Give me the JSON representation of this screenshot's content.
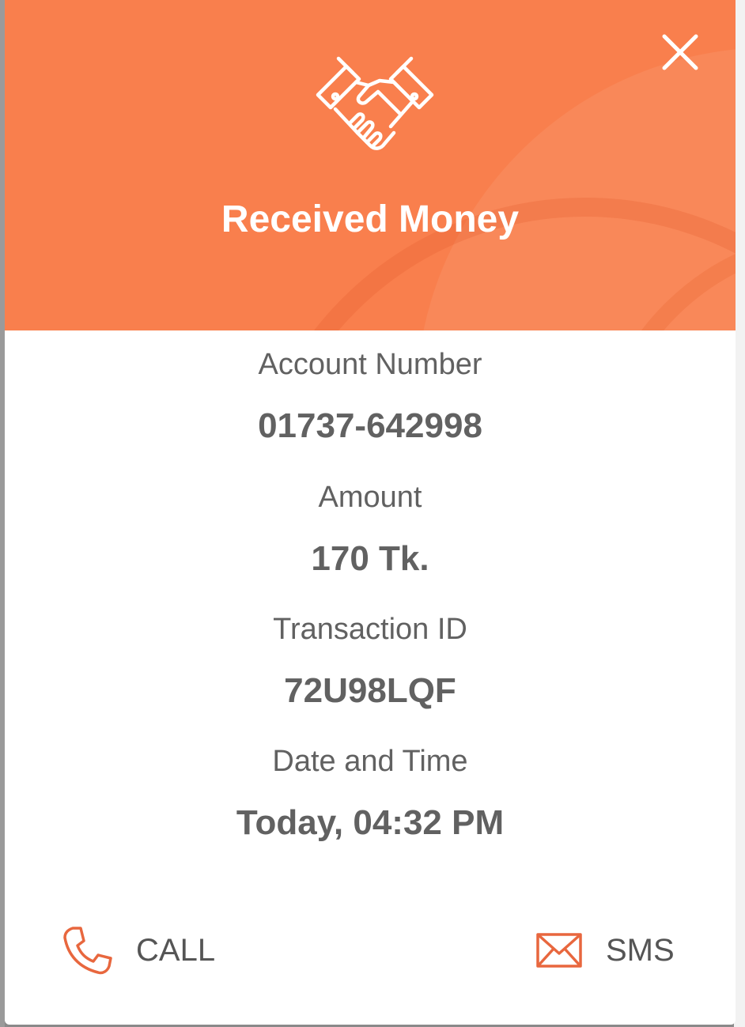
{
  "dialog": {
    "title": "Received Money",
    "close_icon": "close-icon",
    "header_icon": "handshake-icon",
    "accent_color": "#f97f4d"
  },
  "fields": [
    {
      "label": "Account Number",
      "value": "01737-642998"
    },
    {
      "label": "Amount",
      "value": "170 Tk."
    },
    {
      "label": "Transaction ID",
      "value": "72U98LQF"
    },
    {
      "label": "Date and Time",
      "value": "Today, 04:32 PM"
    }
  ],
  "actions": {
    "call": {
      "label": "CALL",
      "icon": "phone-icon"
    },
    "sms": {
      "label": "SMS",
      "icon": "envelope-icon"
    }
  }
}
